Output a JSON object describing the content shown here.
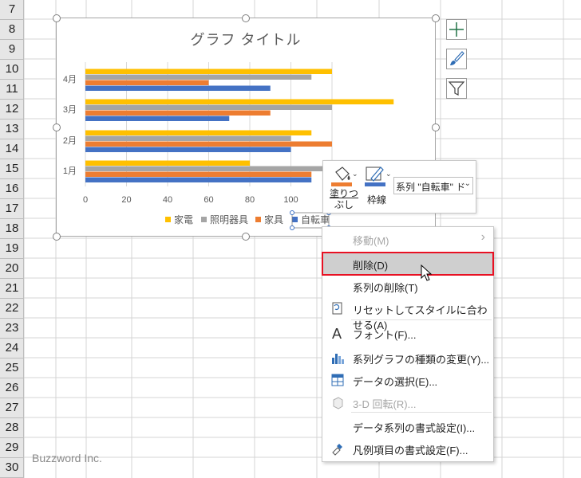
{
  "rows": [
    "7",
    "8",
    "9",
    "10",
    "11",
    "12",
    "13",
    "14",
    "15",
    "16",
    "17",
    "18",
    "19",
    "20",
    "21",
    "22",
    "23",
    "24",
    "25",
    "26",
    "27",
    "28",
    "29",
    "30"
  ],
  "chart": {
    "title": "グラフ タイトル"
  },
  "chart_data": {
    "type": "bar",
    "orientation": "horizontal",
    "categories": [
      "1月",
      "2月",
      "3月",
      "4月"
    ],
    "series": [
      {
        "name": "自転車",
        "color": "#4472c4",
        "values": [
          110,
          100,
          70,
          90
        ]
      },
      {
        "name": "家具",
        "color": "#ed7d31",
        "values": [
          110,
          120,
          90,
          60
        ]
      },
      {
        "name": "照明器具",
        "color": "#a5a5a5",
        "values": [
          120,
          100,
          120,
          110
        ]
      },
      {
        "name": "家電",
        "color": "#ffc000",
        "values": [
          80,
          110,
          150,
          120
        ]
      }
    ],
    "xticks": [
      "0",
      "20",
      "40",
      "60",
      "80",
      "100"
    ],
    "xlim": [
      0,
      120
    ],
    "legend_position": "bottom",
    "grid": true
  },
  "minitoolbar": {
    "fill_label_1": "塗りつ",
    "fill_label_2": "ぶし",
    "outline_label": "枠線",
    "series_select_value": "系列 \"自転車\" ド"
  },
  "menu": {
    "items": [
      {
        "label": "移動(M)",
        "disabled": true,
        "submenu": true
      },
      {
        "label": "削除(D)",
        "highlighted": true
      },
      {
        "label": "系列の削除(T)"
      },
      {
        "label": "リセットしてスタイルに合わせる(A)"
      },
      {
        "label": "フォント(F)..."
      },
      {
        "label": "系列グラフの種類の変更(Y)..."
      },
      {
        "label": "データの選択(E)..."
      },
      {
        "label": "3-D 回転(R)...",
        "disabled": true
      },
      {
        "label": "データ系列の書式設定(I)..."
      },
      {
        "label": "凡例項目の書式設定(F)..."
      }
    ]
  },
  "watermark": "Buzzword Inc.",
  "colors": {
    "highlight_border": "#e81123",
    "highlight_bg": "#cfcfcf",
    "grid": "#d4d4d4",
    "accent_green": "#217346"
  }
}
